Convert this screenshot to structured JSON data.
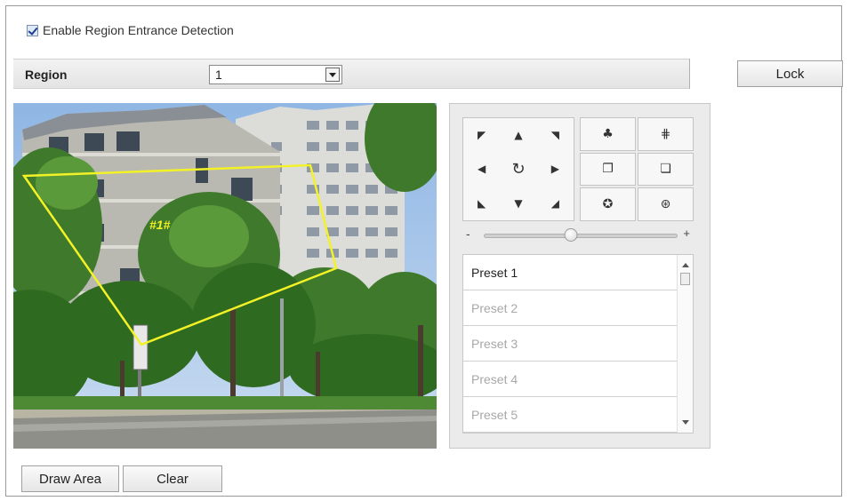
{
  "enable": {
    "label": "Enable Region Entrance Detection",
    "checked": true
  },
  "region": {
    "label": "Region",
    "selected": "1"
  },
  "lock_label": "Lock",
  "video": {
    "region_tag": "#1#"
  },
  "ptz": {
    "direction_icons": [
      "up-left-arrow-icon",
      "up-arrow-icon",
      "up-right-arrow-icon",
      "left-arrow-icon",
      "auto-rotate-icon",
      "right-arrow-icon",
      "down-left-arrow-icon",
      "down-arrow-icon",
      "down-right-arrow-icon"
    ],
    "zoom": {
      "minus": "-",
      "plus": "+",
      "level": 0.45
    },
    "presets": [
      "Preset 1",
      "Preset 2",
      "Preset 3",
      "Preset 4",
      "Preset 5"
    ],
    "active_preset": "Preset 1"
  },
  "buttons": {
    "draw_area": "Draw Area",
    "clear": "Clear"
  },
  "colors": {
    "region_outline": "#f2f226",
    "checkbox_mark": "#1e3f8f"
  }
}
